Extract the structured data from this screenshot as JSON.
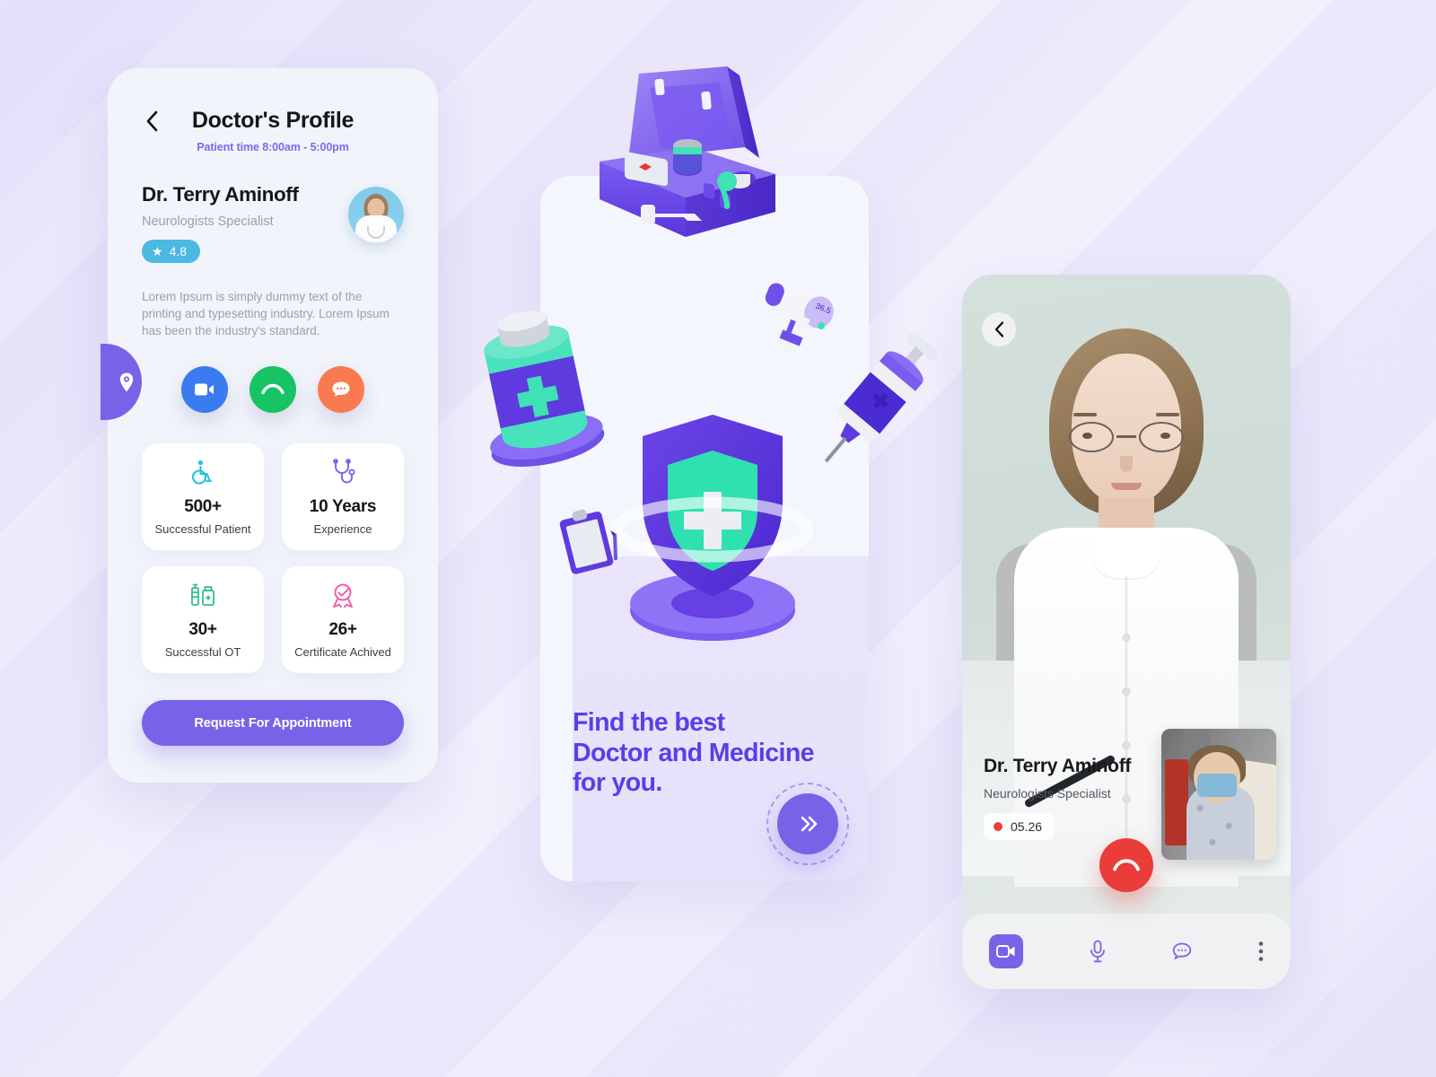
{
  "colors": {
    "brand_purple": "#7a62e8",
    "deep_purple": "#5b3ee8",
    "teal": "#2fe0b0",
    "rating_blue": "#4cb9e0",
    "video_blue": "#3a7bf0",
    "call_green": "#16c463",
    "chat_orange": "#fa7a4f",
    "end_red": "#ea3c38",
    "background": "#ece9fb"
  },
  "profile_screen": {
    "back_icon": "chevron-left-icon",
    "title": "Doctor's Profile",
    "subtitle": "Patient time 8:00am - 5:00pm",
    "doctor_name": "Dr. Terry Aminoff",
    "doctor_role": "Neurologists Specialist",
    "rating_icon": "star-icon",
    "rating": "4.8",
    "description": "Lorem Ipsum is simply dummy text of the printing and typesetting industry. Lorem Ipsum has been the industry's standard.",
    "location_tab_icon": "location-pin-icon",
    "actions": [
      {
        "name": "video-call-button",
        "icon": "video-camera-icon",
        "color": "#3a7bf0"
      },
      {
        "name": "voice-call-button",
        "icon": "phone-icon",
        "color": "#16c463"
      },
      {
        "name": "chat-button",
        "icon": "chat-bubble-icon",
        "color": "#fa7a4f"
      }
    ],
    "stats": [
      {
        "icon": "wheelchair-icon",
        "value": "500+",
        "label": "Successful Patient",
        "color": "#22c3e0"
      },
      {
        "icon": "stethoscope-icon",
        "value": "10 Years",
        "label": "Experience",
        "color": "#7a62e8"
      },
      {
        "icon": "syringe-medicine-icon",
        "value": "30+",
        "label": "Successful OT",
        "color": "#2fbf8f"
      },
      {
        "icon": "certificate-badge-icon",
        "value": "26+",
        "label": "Certificate Achived",
        "color": "#f05fa8"
      }
    ],
    "cta_label": "Request For Appointment"
  },
  "onboarding_screen": {
    "heading_line1": "Find the best",
    "heading_line2": "Doctor and Medicine",
    "heading_line3": "for you.",
    "next_icon": "double-chevron-right-icon",
    "illustrations": [
      "medical-kit-3d",
      "thermometer-gun-3d",
      "medicine-vial-3d",
      "syringe-3d",
      "shield-cross-3d",
      "clipboard-3d"
    ]
  },
  "call_screen": {
    "back_icon": "chevron-left-icon",
    "doctor_name": "Dr. Terry Aminoff",
    "doctor_role": "Neurologists Specialist",
    "recording_indicator": "record-dot-icon",
    "call_duration": "05.26",
    "end_call_icon": "phone-hangup-icon",
    "pip_label": "patient-self-view",
    "bottom_bar": [
      {
        "name": "toggle-video-button",
        "icon": "video-camera-icon",
        "active": true
      },
      {
        "name": "toggle-mic-button",
        "icon": "microphone-icon",
        "active": false
      },
      {
        "name": "open-chat-button",
        "icon": "chat-bubble-icon",
        "active": false
      },
      {
        "name": "more-options-button",
        "icon": "kebab-menu-icon",
        "active": false
      }
    ]
  }
}
